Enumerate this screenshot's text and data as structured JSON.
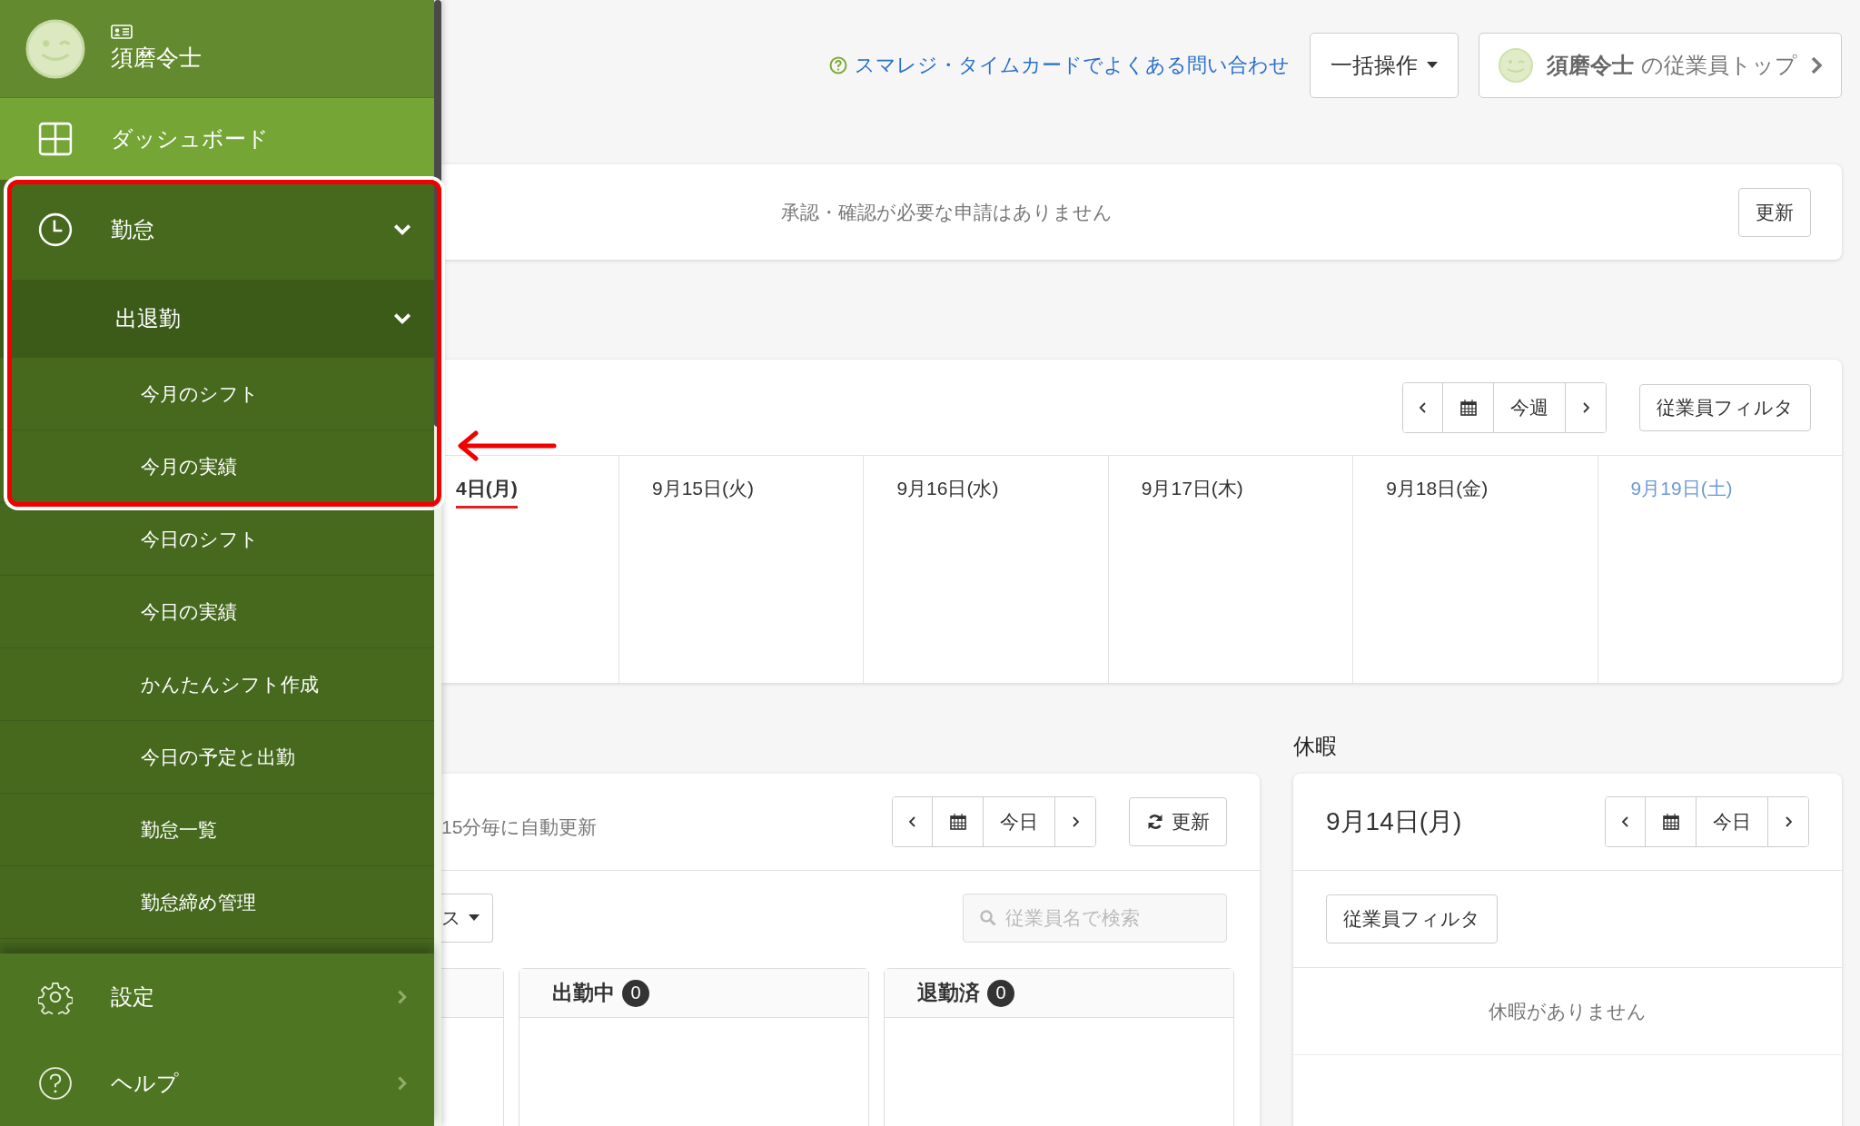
{
  "sidebar": {
    "user": {
      "name": "須磨令士"
    },
    "items": [
      {
        "label": "ダッシュボード",
        "selected": true
      },
      {
        "label": "勤怠",
        "selected": false,
        "expanded": true,
        "children": [
          {
            "label": "出退勤",
            "expanded": true,
            "children": [
              {
                "label": "今月のシフト"
              },
              {
                "label": "今月の実績"
              },
              {
                "label": "今日のシフト"
              },
              {
                "label": "今日の実績"
              },
              {
                "label": "かんたんシフト作成"
              },
              {
                "label": "今日の予定と出勤"
              },
              {
                "label": "勤怠一覧"
              },
              {
                "label": "勤怠締め管理"
              }
            ]
          }
        ]
      }
    ],
    "footer_items": [
      {
        "label": "設定",
        "expanded": false
      },
      {
        "label": "ヘルプ",
        "expanded": false
      }
    ]
  },
  "top_bar": {
    "help_link": "スマレジ・タイムカードでよくある問い合わせ",
    "bulk_button": "一括操作",
    "employee_top": {
      "name": "須磨令士",
      "suffix": "の従業員トップ"
    }
  },
  "approvals": {
    "message": "承認・確認が必要な申請はありません",
    "refresh": "更新"
  },
  "week": {
    "today_label": "今週",
    "filter": "従業員フィルタ",
    "days": [
      {
        "label": "4日(月)",
        "today": true,
        "kind": "weekday"
      },
      {
        "label": "9月15日(火)",
        "today": false,
        "kind": "weekday"
      },
      {
        "label": "9月16日(水)",
        "today": false,
        "kind": "weekday"
      },
      {
        "label": "9月17日(木)",
        "today": false,
        "kind": "weekday"
      },
      {
        "label": "9月18日(金)",
        "today": false,
        "kind": "weekday"
      },
      {
        "label": "9月19日(土)",
        "today": false,
        "kind": "saturday"
      }
    ]
  },
  "attendance": {
    "auto_refresh": "15分毎に自動更新",
    "today_label": "今日",
    "refresh": "更新",
    "status_dropdown": "ス",
    "search": {
      "placeholder": "従業員名で検索"
    },
    "columns": [
      {
        "title": "出勤中",
        "count": "0"
      },
      {
        "title": "退勤済",
        "count": "0"
      }
    ]
  },
  "leave": {
    "heading": "休暇",
    "date": "9月14日(月)",
    "today_label": "今日",
    "filter": "従業員フィルタ",
    "empty": "休暇がありません"
  }
}
